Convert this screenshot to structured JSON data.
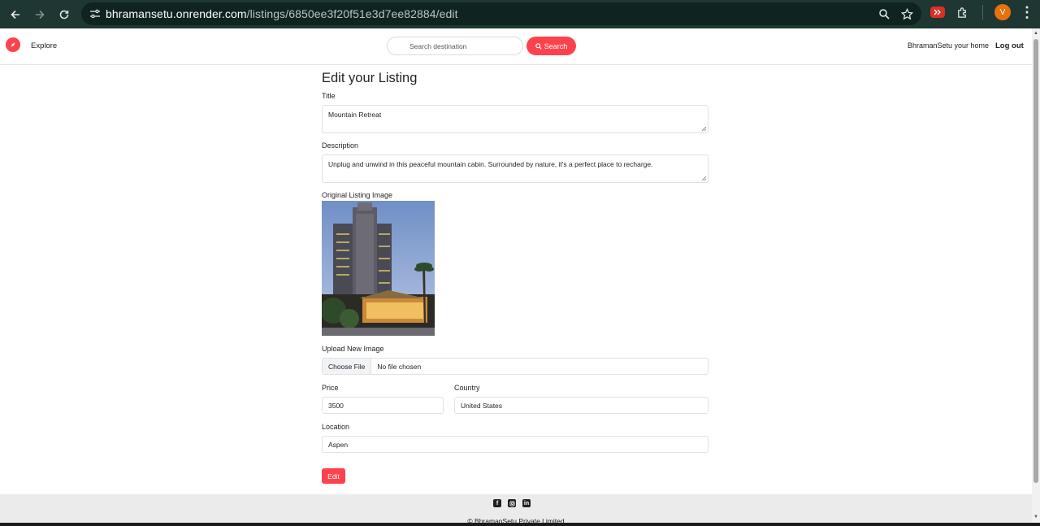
{
  "browser": {
    "url_host": "bhramansetu.onrender.com",
    "url_path": "/listings/6850ee3f20f51e3d7ee82884/edit",
    "profile_initial": "V",
    "icons": [
      "back-arrow-icon",
      "forward-arrow-icon",
      "reload-icon",
      "site-info-icon",
      "zoom-icon",
      "bookmark-star-icon",
      "extension-icon",
      "puzzle-icon",
      "kebab-menu-icon"
    ]
  },
  "navbar": {
    "explore_label": "Explore",
    "search_placeholder": "Search destination",
    "search_button": "Search",
    "home_link": "BhramanSetu your home",
    "logout_link": "Log out",
    "brand_color": "#fe424d"
  },
  "form": {
    "heading": "Edit your Listing",
    "title_label": "Title",
    "title_value": "Mountain Retreat",
    "description_label": "Description",
    "description_value": "Unplug and unwind in this peaceful mountain cabin. Surrounded by nature, it's a perfect place to recharge.",
    "original_image_label": "Original Listing Image",
    "upload_label": "Upload New Image",
    "choose_file_button": "Choose File",
    "no_file_text": "No file chosen",
    "price_label": "Price",
    "price_value": "3500",
    "country_label": "Country",
    "country_value": "United States",
    "location_label": "Location",
    "location_value": "Aspen",
    "submit_button": "Edit"
  },
  "footer": {
    "social_icons": [
      "facebook-icon",
      "instagram-icon",
      "linkedin-icon"
    ],
    "copyright": "© BhramanSetu Private Limited"
  }
}
